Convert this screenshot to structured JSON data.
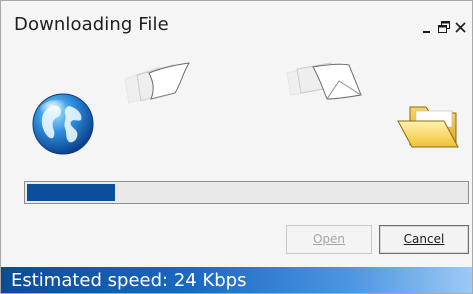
{
  "window": {
    "title": "Downloading File",
    "controls": {
      "minimize_icon": "minimize-icon",
      "restore_icon": "restore-icon",
      "close_icon": "close-icon"
    }
  },
  "animation": {
    "source_icon": "globe-icon",
    "moving_icons": [
      "paper-icon",
      "paper-icon"
    ],
    "destination_icon": "folder-icon"
  },
  "progress": {
    "fraction": 0.2,
    "fill_color": "#0a4f9c"
  },
  "buttons": {
    "open_label": "Open",
    "open_enabled": false,
    "cancel_label": "Cancel"
  },
  "status": {
    "text": "Estimated speed: 24 Kbps",
    "gradient_colors": [
      "#0d4c95",
      "#9ccaf5"
    ]
  }
}
